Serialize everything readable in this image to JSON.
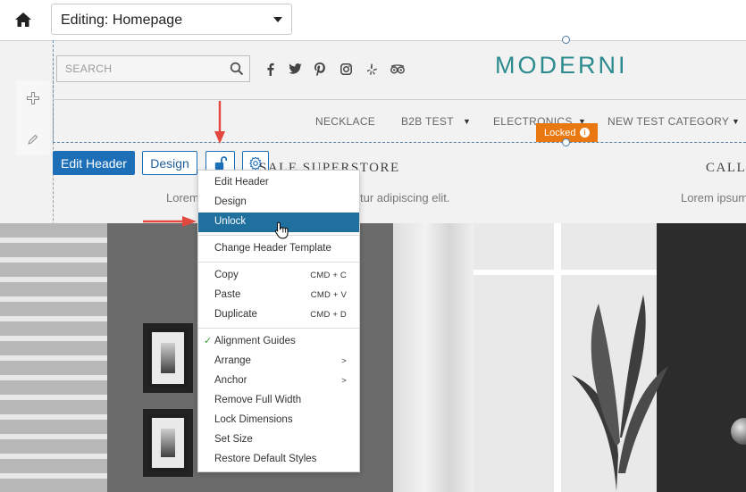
{
  "topbar": {
    "page_select_label": "Editing: Homepage"
  },
  "header": {
    "search_placeholder": "SEARCH",
    "logo_text": "MODERNI",
    "social_icons": [
      "facebook-icon",
      "twitter-icon",
      "pinterest-icon",
      "instagram-icon",
      "yelp-icon",
      "tripadvisor-icon"
    ],
    "nav_items": [
      {
        "label": "NECKLACE",
        "has_dropdown": false
      },
      {
        "label": "B2B TEST",
        "has_dropdown": true
      },
      {
        "label": "ELECTRONICS",
        "has_dropdown": true
      },
      {
        "label": "NEW TEST CATEGORY",
        "has_dropdown": true
      }
    ],
    "locked_badge": "Locked",
    "locked_info": "i"
  },
  "toolbar": {
    "edit_header_label": "Edit Header",
    "design_label": "Design"
  },
  "content": {
    "store_title": "SALE SUPERSTORE",
    "call_title": "CALL",
    "lorem_left": "Lorem",
    "lorem_mid": "tur adipiscing elit.",
    "lorem_right": "Lorem ipsum"
  },
  "context_menu": {
    "groups": [
      [
        {
          "label": "Edit Header"
        },
        {
          "label": "Design"
        },
        {
          "label": "Unlock",
          "active": true
        }
      ],
      [
        {
          "label": "Change Header Template"
        }
      ],
      [
        {
          "label": "Copy",
          "shortcut": "CMD + C"
        },
        {
          "label": "Paste",
          "shortcut": "CMD + V"
        },
        {
          "label": "Duplicate",
          "shortcut": "CMD + D"
        }
      ],
      [
        {
          "label": "Alignment Guides",
          "checked": true,
          "check": "✓"
        },
        {
          "label": "Arrange",
          "submenu": ">"
        },
        {
          "label": "Anchor",
          "submenu": ">"
        },
        {
          "label": "Remove Full Width"
        },
        {
          "label": "Lock Dimensions"
        },
        {
          "label": "Set Size"
        },
        {
          "label": "Restore Default Styles"
        }
      ]
    ]
  },
  "colors": {
    "primary_blue": "#1d6fb8",
    "menu_active": "#1f6f9f",
    "locked_orange": "#e8780f",
    "logo_teal": "#2c8b8f",
    "arrow_red": "#e2483f"
  }
}
